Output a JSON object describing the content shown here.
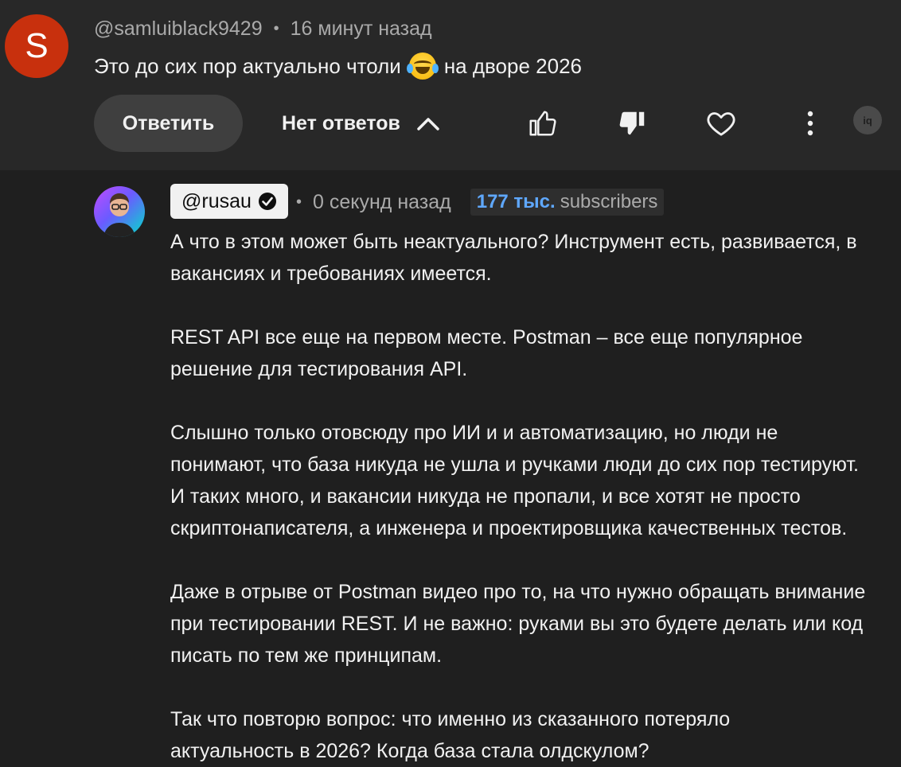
{
  "comment": {
    "avatar_letter": "S",
    "avatar_color": "#c8300d",
    "author": "@samluiblack9429",
    "separator": "•",
    "time": "16 минут назад",
    "text_before_emoji": "Это до сих пор актуально чтоли",
    "emoji_icon": "face-with-tears-of-joy-icon",
    "text_after_emoji": "на дворе 2026",
    "actions": {
      "reply_label": "Ответить",
      "replies_label": "Нет ответов",
      "replies_toggle_icon": "chevron-up-icon",
      "like_icon": "thumb-up-icon",
      "dislike_icon": "thumb-down-icon",
      "heart_icon": "heart-icon",
      "more_icon": "more-vertical-icon",
      "badge_label": "iq"
    }
  },
  "reply": {
    "author": "@rusau",
    "verified_icon": "verified-check-icon",
    "separator": "•",
    "time": "0 секунд назад",
    "subscriber_count": "177 тыс.",
    "subscriber_label": "subscribers",
    "lines": [
      "А что в этом может быть неактуального? Инструмент есть, развивается, в",
      "вакансиях и требованиях имеется.",
      "REST API  все еще на первом месте. Postman – все еще популярное",
      "решение для тестирования API.",
      "Слышно только отовсюду про ИИ и и автоматизацию, но люди не",
      "понимают, что база никуда не ушла и ручками люди до сих пор тестируют.",
      "И таких много, и вакансии никуда не пропали, и все хотят не просто",
      "скриптонаписателя, а инженера и проектировщика качественных тестов.",
      "Даже в отрыве от Postman видео про то, на что нужно обращать внимание",
      "при тестировании REST. И не важно: руками вы это будете делать или код",
      "писать по тем же принципам.",
      "Так что повторю вопрос: что именно из сказанного потеряло",
      "актуальность в 2026? Когда база стала олдскулом?"
    ]
  }
}
